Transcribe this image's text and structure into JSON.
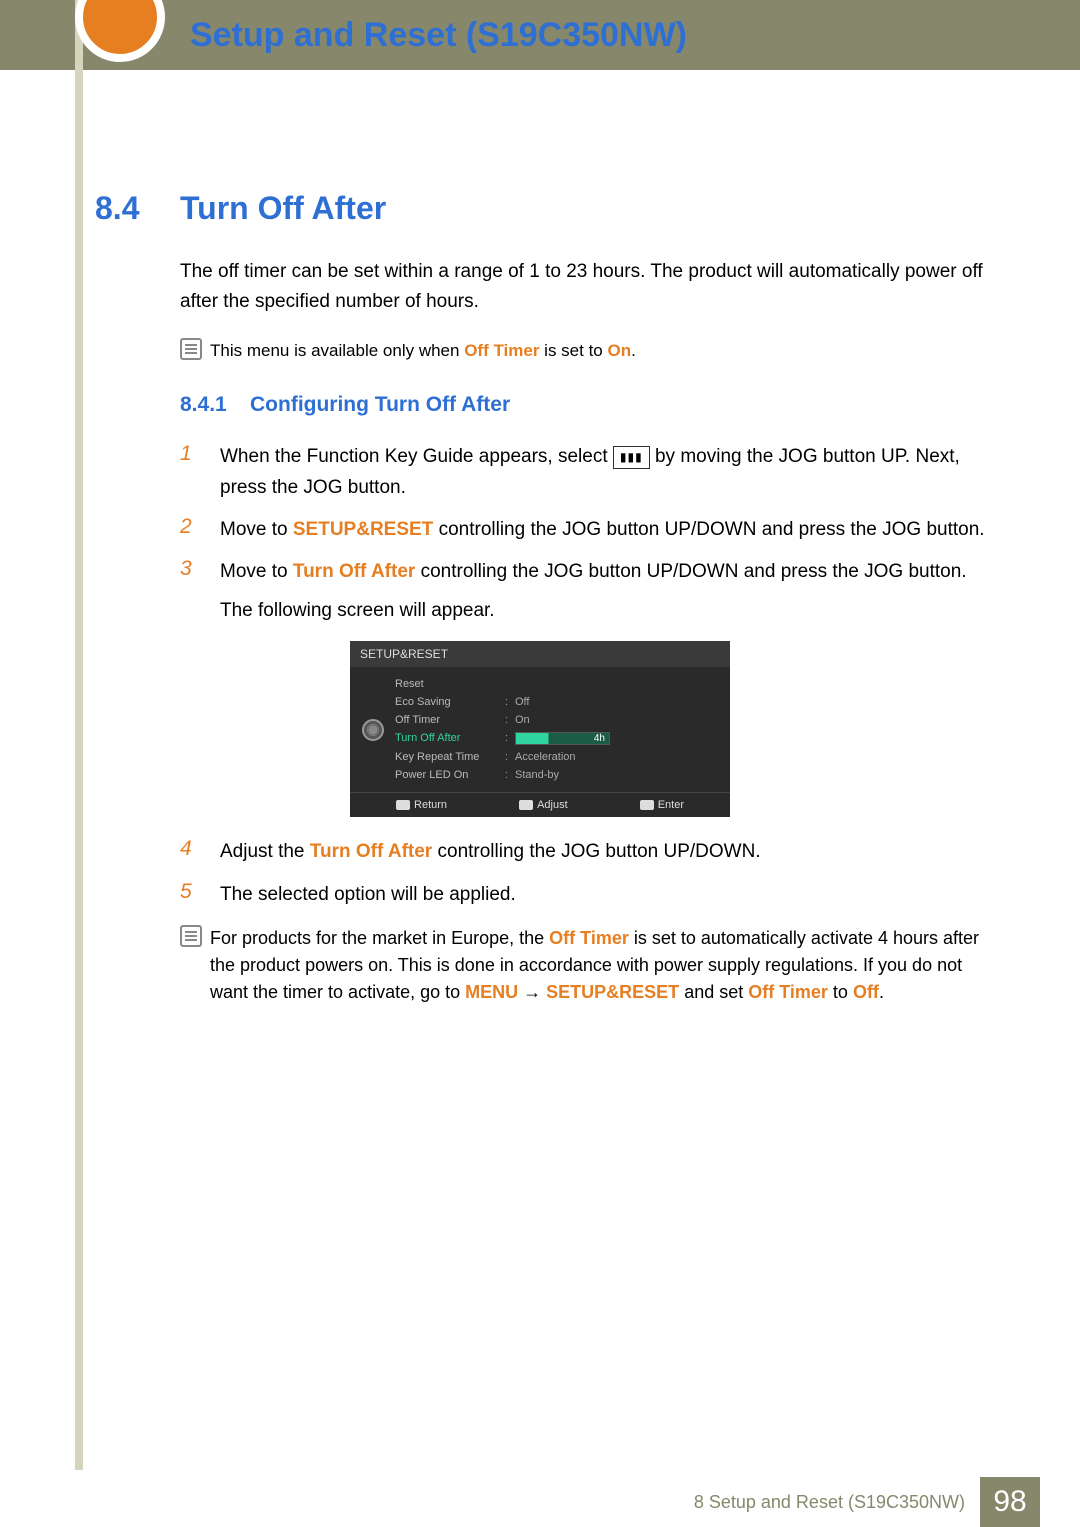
{
  "header": {
    "page_title": "Setup and Reset (S19C350NW)"
  },
  "section": {
    "number": "8.4",
    "title": "Turn Off After",
    "intro": "The off timer can be set within a range of 1 to 23 hours. The product will automatically power off after the specified number of hours.",
    "note_prefix": "This menu is available only when ",
    "note_hl1": "Off Timer",
    "note_mid": " is set to ",
    "note_hl2": "On",
    "note_suffix": "."
  },
  "subsection": {
    "number": "8.4.1",
    "title": "Configuring Turn Off After"
  },
  "steps": {
    "s1num": "1",
    "s1a": "When the Function Key Guide appears, select ",
    "s1b": " by moving the JOG button UP. Next, press the JOG button.",
    "s2num": "2",
    "s2a": "Move to ",
    "s2hl": "SETUP&RESET",
    "s2b": " controlling the JOG button UP/DOWN and press the JOG button.",
    "s3num": "3",
    "s3a": "Move to ",
    "s3hl": "Turn Off After",
    "s3b": " controlling the JOG button UP/DOWN and press the JOG button.",
    "s3c": "The following screen will appear.",
    "s4num": "4",
    "s4a": "Adjust the ",
    "s4hl": "Turn Off After",
    "s4b": " controlling the JOG button UP/DOWN.",
    "s5num": "5",
    "s5a": "The selected option will be applied."
  },
  "osd": {
    "title": "SETUP&RESET",
    "items": [
      {
        "label": "Reset",
        "value": ""
      },
      {
        "label": "Eco Saving",
        "value": "Off"
      },
      {
        "label": "Off Timer",
        "value": "On"
      },
      {
        "label": "Turn Off After",
        "value": "4h"
      },
      {
        "label": "Key Repeat Time",
        "value": "Acceleration"
      },
      {
        "label": "Power LED On",
        "value": "Stand-by"
      }
    ],
    "footer": {
      "return": "Return",
      "adjust": "Adjust",
      "enter": "Enter"
    }
  },
  "note2": {
    "a": "For products for the market in Europe, the ",
    "hl1": "Off Timer",
    "b": " is set to automatically activate 4 hours after the product powers on. This is done in accordance with power supply regulations. If you do not want the timer to activate, go to ",
    "hl2": "MENU",
    "arrow": " → ",
    "hl3": "SETUP&RESET",
    "c": " and set ",
    "hl4": "Off Timer",
    "d": " to ",
    "hl5": "Off",
    "e": "."
  },
  "footer": {
    "text": "8 Setup and Reset (S19C350NW)",
    "page": "98"
  }
}
